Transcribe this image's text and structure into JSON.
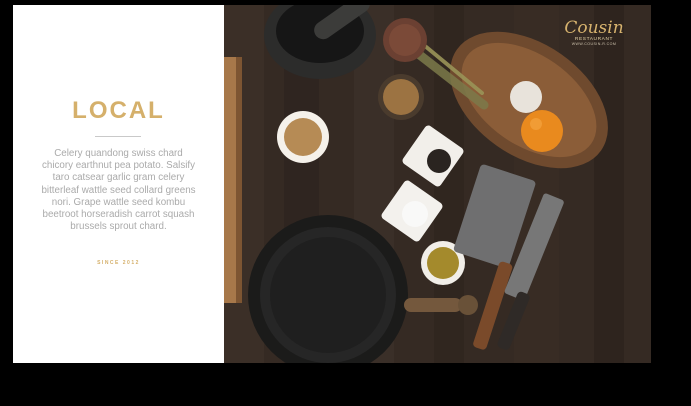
{
  "slide": {
    "title": "LOCAL",
    "body": "Celery quandong swiss chard chicory earthnut pea potato. Salsify taro catsear garlic gram celery bitterleaf wattle seed collard greens nori. Grape wattle seed kombu beetroot horseradish carrot squash brussels sprout chard.",
    "since": "SINCE 2012"
  },
  "logo": {
    "script": "Cousin",
    "sub": "RESTAURANT",
    "url": "WWW.COUSIN-R.COM"
  },
  "colors": {
    "accent": "#d5b06b",
    "text_gray": "#aaaaaa",
    "wood": "#3a2e26"
  },
  "image_subject": "kitchen-table-top-view"
}
